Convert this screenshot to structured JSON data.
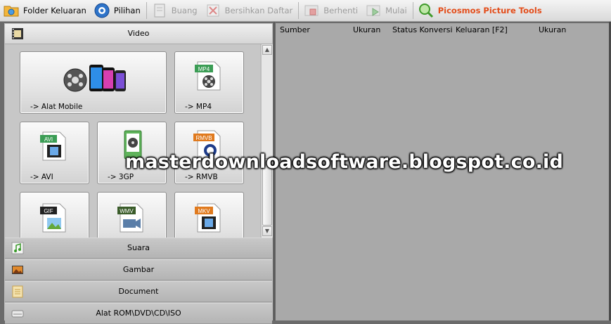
{
  "toolbar": {
    "output_folder": "Folder Keluaran",
    "options": "Pilihan",
    "remove": "Buang",
    "clear_list": "Bersihkan Daftar",
    "stop": "Berhenti",
    "start": "Mulai",
    "picture_tools": "Picosmos Picture Tools"
  },
  "left_panel": {
    "video_header": "Video",
    "tiles": [
      {
        "label": "-> Alat Mobile",
        "icon": "mobile-devices-icon"
      },
      {
        "label": "-> MP4",
        "icon": "mp4-icon",
        "badge": "MP4"
      },
      {
        "label": "-> AVI",
        "icon": "avi-icon",
        "badge": "AVI"
      },
      {
        "label": "-> 3GP",
        "icon": "3gp-icon"
      },
      {
        "label": "-> RMVB",
        "icon": "rmvb-icon",
        "badge": "RMVB"
      },
      {
        "label": "",
        "icon": "gif-icon",
        "badge": "GIF"
      },
      {
        "label": "",
        "icon": "wmv-icon",
        "badge": "WMV"
      },
      {
        "label": "",
        "icon": "mkv-icon",
        "badge": "MKV"
      }
    ],
    "categories": [
      {
        "label": "Suara",
        "icon": "music-icon"
      },
      {
        "label": "Gambar",
        "icon": "picture-icon"
      },
      {
        "label": "Document",
        "icon": "document-icon"
      },
      {
        "label": "Alat ROM\\DVD\\CD\\ISO",
        "icon": "disc-drive-icon"
      }
    ]
  },
  "file_list": {
    "columns": [
      "Sumber",
      "Ukuran",
      "Status Konversi",
      "Keluaran [F2]",
      "Ukuran"
    ]
  },
  "watermark": "masterdownloadsoftware.blogspot.co.id",
  "colors": {
    "brand_text": "#e34d1a",
    "panel_bg": "#a9a9a9",
    "disabled_text": "#9c9c9c"
  }
}
